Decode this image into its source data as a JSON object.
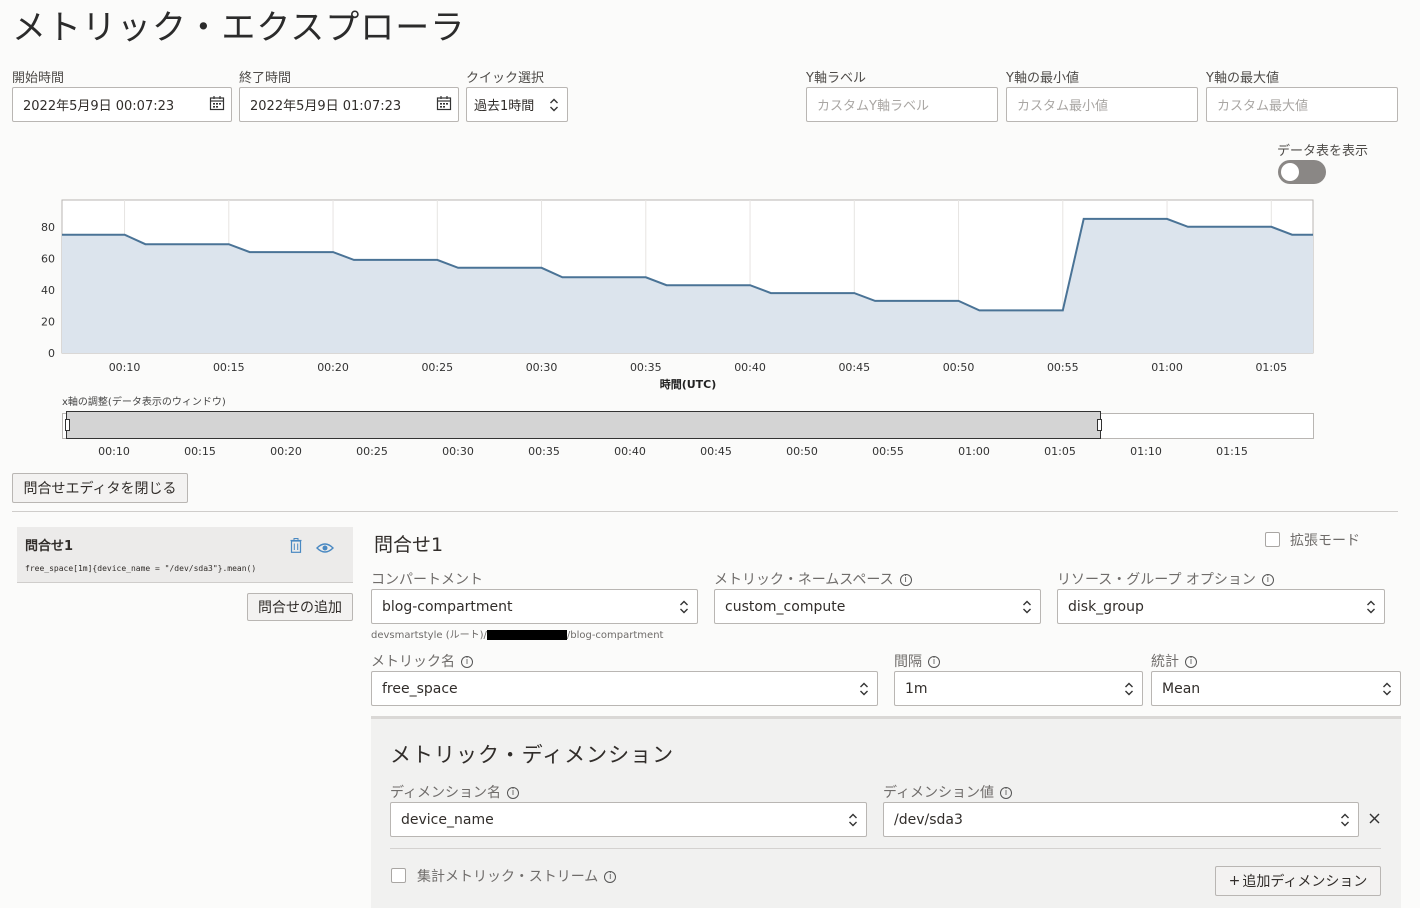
{
  "page": {
    "title": "メトリック・エクスプローラ"
  },
  "range": {
    "start_label": "開始時間",
    "start_value": "2022年5月9日 00:07:23",
    "end_label": "終了時間",
    "end_value": "2022年5月9日 01:07:23",
    "quick_label": "クイック選択",
    "quick_value": "過去1時間"
  },
  "yaxis": {
    "label_label": "Y軸ラベル",
    "label_placeholder": "カスタムY軸ラベル",
    "min_label": "Y軸の最小値",
    "min_placeholder": "カスタム最小値",
    "max_label": "Y軸の最大値",
    "max_placeholder": "カスタム最大値"
  },
  "toggle": {
    "label": "データ表を表示",
    "on": false
  },
  "chart_data": {
    "type": "area",
    "x": [
      "00:07",
      "00:10",
      "00:11",
      "00:15",
      "00:16",
      "00:20",
      "00:21",
      "00:25",
      "00:26",
      "00:30",
      "00:31",
      "00:35",
      "00:36",
      "00:40",
      "00:41",
      "00:45",
      "00:46",
      "00:50",
      "00:51",
      "00:55",
      "00:56",
      "01:00",
      "01:01",
      "01:05",
      "01:06",
      "01:07"
    ],
    "values": [
      75,
      75,
      69,
      69,
      64,
      64,
      59,
      59,
      54,
      54,
      48,
      48,
      43,
      43,
      38,
      38,
      33,
      33,
      27,
      27,
      85,
      85,
      80,
      80,
      75,
      75
    ],
    "xticks": [
      "00:10",
      "00:15",
      "00:20",
      "00:25",
      "00:30",
      "00:35",
      "00:40",
      "00:45",
      "00:50",
      "00:55",
      "01:00",
      "01:05"
    ],
    "yticks": [
      0,
      20,
      40,
      60,
      80
    ],
    "ylim": [
      0,
      97
    ],
    "xlabel": "時間(UTC)",
    "grid": true,
    "line_color": "#4a7396",
    "fill_color": "#dce4ed"
  },
  "navigator": {
    "label": "x軸の調整(データ表示のウィンドウ)",
    "ticks": [
      "00:10",
      "00:15",
      "00:20",
      "00:25",
      "00:30",
      "00:35",
      "00:40",
      "00:45",
      "00:50",
      "00:55",
      "01:00",
      "01:05",
      "01:10",
      "01:15"
    ]
  },
  "close_editor_label": "問合せエディタを閉じる",
  "query_card": {
    "title": "問合せ1",
    "expression": "free_space[1m]{device_name = \"/dev/sda3\"}.mean()",
    "add_label": "問合せの追加"
  },
  "editor": {
    "title": "問合せ1",
    "advanced_label": "拡張モード",
    "compartment_label": "コンパートメント",
    "compartment_value": "blog-compartment",
    "compartment_path_prefix": "devsmartstyle (ルート)/",
    "compartment_path_suffix": "/blog-compartment",
    "namespace_label": "メトリック・ネームスペース",
    "namespace_value": "custom_compute",
    "resource_group_label": "リソース・グループ オプション",
    "resource_group_value": "disk_group",
    "metric_label": "メトリック名",
    "metric_value": "free_space",
    "interval_label": "間隔",
    "interval_value": "1m",
    "stat_label": "統計",
    "stat_value": "Mean"
  },
  "dimensions": {
    "title": "メトリック・ディメンション",
    "name_label": "ディメンション名",
    "name_value": "device_name",
    "value_label": "ディメンション値",
    "value_value": "/dev/sda3",
    "aggregate_label": "集計メトリック・ストリーム",
    "add_label": "追加ディメンション"
  }
}
